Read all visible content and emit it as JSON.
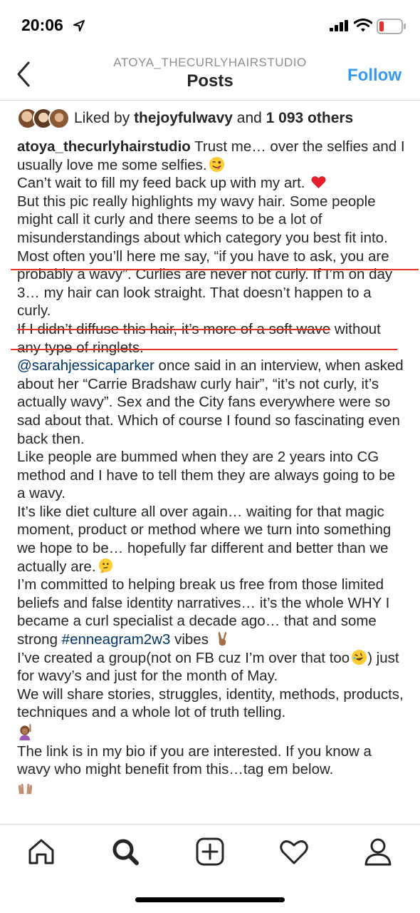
{
  "status_bar": {
    "time": "20:06"
  },
  "header": {
    "account": "ATOYA_THECURLYHAIRSTUDIO",
    "title": "Posts",
    "follow_label": "Follow"
  },
  "likes": {
    "prefix": "Liked by ",
    "user": "thejoyfulwavy",
    "middle": " and ",
    "count": "1 093 others"
  },
  "caption": {
    "username": "atoya_thecurlyhairstudio",
    "p1": " Trust me… over the selfies and I usually love me some selfies.",
    "p2": "Can’t wait to fill my feed back up with my art.",
    "p3": "But this pic really highlights my wavy hair. Some people might call it curly and there seems to be a lot of misunderstandings about which category you best fit into.",
    "p4": "Most often you’ll here me say, “if you have to ask, you are probably a wavy”. Curlies are never not curly. If I’m on day 3… my hair can look straight. That doesn’t happen to a curly.",
    "p5_struck": "If I didn’t diffuse this hair, it’s more of a soft wave",
    "p5_rest": " without any type of ringlets.",
    "p6_mention": "@sarahjessicaparker",
    "p6": " once said in an interview, when asked about her “Carrie Bradshaw curly hair”, “it’s not curly, it’s actually wavy”. Sex and the City fans everywhere were so sad about that. Which of course I found so fascinating even back then.",
    "p7": "Like people are bummed when they are 2 years into CG method and I have to tell them they are always going to be a wavy.",
    "p8": "It’s like diet culture all over again… waiting for that magic moment, product or method where we turn into something we hope to be… hopefully far different and better than we actually are.",
    "p9a": "I’m committed to helping break us free from those limited beliefs and false identity narratives… it’s the whole WHY I became a curl specialist a decade ago… that and some strong ",
    "p9_hashtag": "#enneagram2w3",
    "p9b": " vibes",
    "p10a": "I’ve created a group(not on FB cuz I’m over that too",
    "p10b": ") just for wavy’s and just for the month of May.",
    "p11": "We will share stories, struggles, identity, methods, products, techniques and a whole lot of truth telling.",
    "p12": "The link is in my bio if you are interested. If you know a wavy who might benefit from this…tag em below."
  },
  "colors": {
    "link": "#003569",
    "follow": "#3897f0",
    "annotation": "#e8302a"
  },
  "tabs": [
    "home-icon",
    "search-icon",
    "new-post-icon",
    "activity-heart-icon",
    "profile-icon"
  ]
}
